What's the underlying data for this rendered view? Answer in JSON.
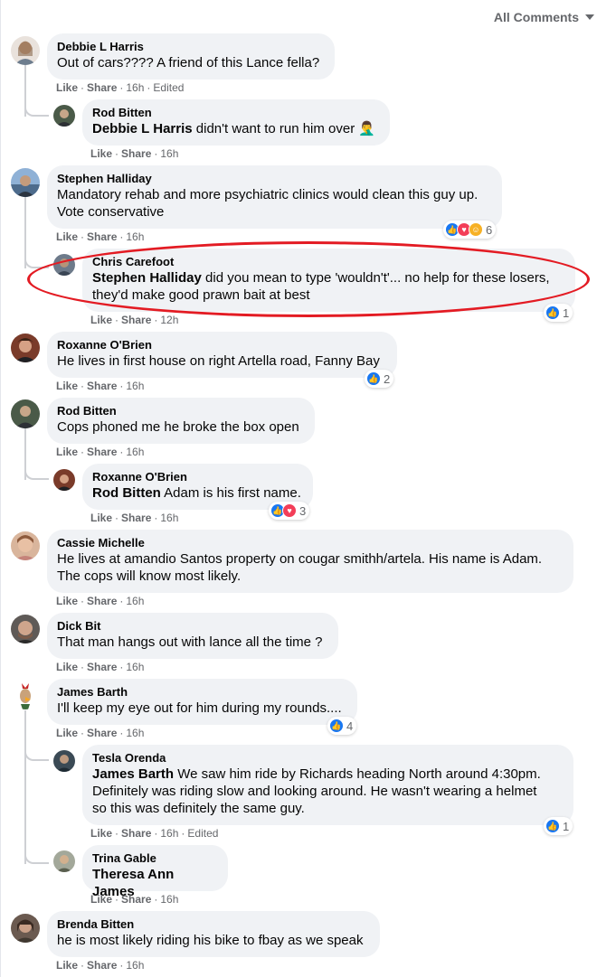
{
  "header": {
    "sort_label": "All Comments"
  },
  "actions": {
    "like": "Like",
    "share": "Share",
    "separator": "·"
  },
  "colors": {
    "link": "#65676b",
    "bubble": "#f0f2f5",
    "like": "#1877f2",
    "love": "#f33e58",
    "haha": "#f7b125",
    "annotation": "#e31b23"
  },
  "comments": [
    {
      "author": "Debbie L Harris",
      "text": "Out of cars???? A friend of this Lance fella?",
      "time": "16h",
      "edited": "Edited"
    },
    {
      "author": "Rod Bitten",
      "tag": "Debbie L Harris",
      "text": "didn't want to run him over 🤦‍♂️",
      "time": "16h"
    },
    {
      "author": "Stephen Halliday",
      "text": "Mandatory rehab and more psychiatric clinics would clean this guy up.\nVote conservative",
      "time": "16h",
      "reactions": {
        "icons": [
          "like-icon",
          "love-icon",
          "haha-icon"
        ],
        "count": "6"
      }
    },
    {
      "author": "Chris Carefoot",
      "tag": "Stephen Halliday",
      "text": "did you mean to type 'wouldn't'... no help for these losers,\nthey'd make good prawn bait at best",
      "time": "12h",
      "reactions": {
        "icons": [
          "like-icon"
        ],
        "count": "1"
      }
    },
    {
      "author": "Roxanne O'Brien",
      "text": "He lives in first house on right Artella road, Fanny Bay",
      "time": "16h",
      "reactions": {
        "icons": [
          "like-icon"
        ],
        "count": "2"
      }
    },
    {
      "author": "Rod Bitten",
      "text": "Cops phoned me he broke the box open",
      "time": "16h"
    },
    {
      "author": "Roxanne O'Brien",
      "tag": "Rod Bitten",
      "text": "Adam is his first name.",
      "time": "16h",
      "reactions": {
        "icons": [
          "like-icon",
          "love-icon"
        ],
        "count": "3"
      }
    },
    {
      "author": "Cassie Michelle",
      "text": "He lives at amandio Santos property on cougar smithh/artela. His name is Adam.\nThe cops will know most likely.",
      "time": "16h"
    },
    {
      "author": "Dick Bit",
      "text": "That man hangs out with lance all the time ?",
      "time": "16h"
    },
    {
      "author": "James Barth",
      "text": "I'll keep my eye out for him during my rounds....",
      "time": "16h",
      "reactions": {
        "icons": [
          "like-icon"
        ],
        "count": "4"
      }
    },
    {
      "author": "Tesla Orenda",
      "tag": "James Barth",
      "text": "We saw him ride by Richards heading North around 4:30pm.\nDefinitely was riding slow and looking around. He wasn't wearing a helmet\nso this was definitely the same guy.",
      "time": "16h",
      "edited": "Edited",
      "reactions": {
        "icons": [
          "like-icon"
        ],
        "count": "1"
      }
    },
    {
      "author": "Trina Gable",
      "tag": "Theresa Ann James",
      "text": "",
      "time": "16h"
    },
    {
      "author": "Brenda Bitten",
      "text": "he is most likely riding his bike to fbay as we speak",
      "time": "16h"
    }
  ]
}
